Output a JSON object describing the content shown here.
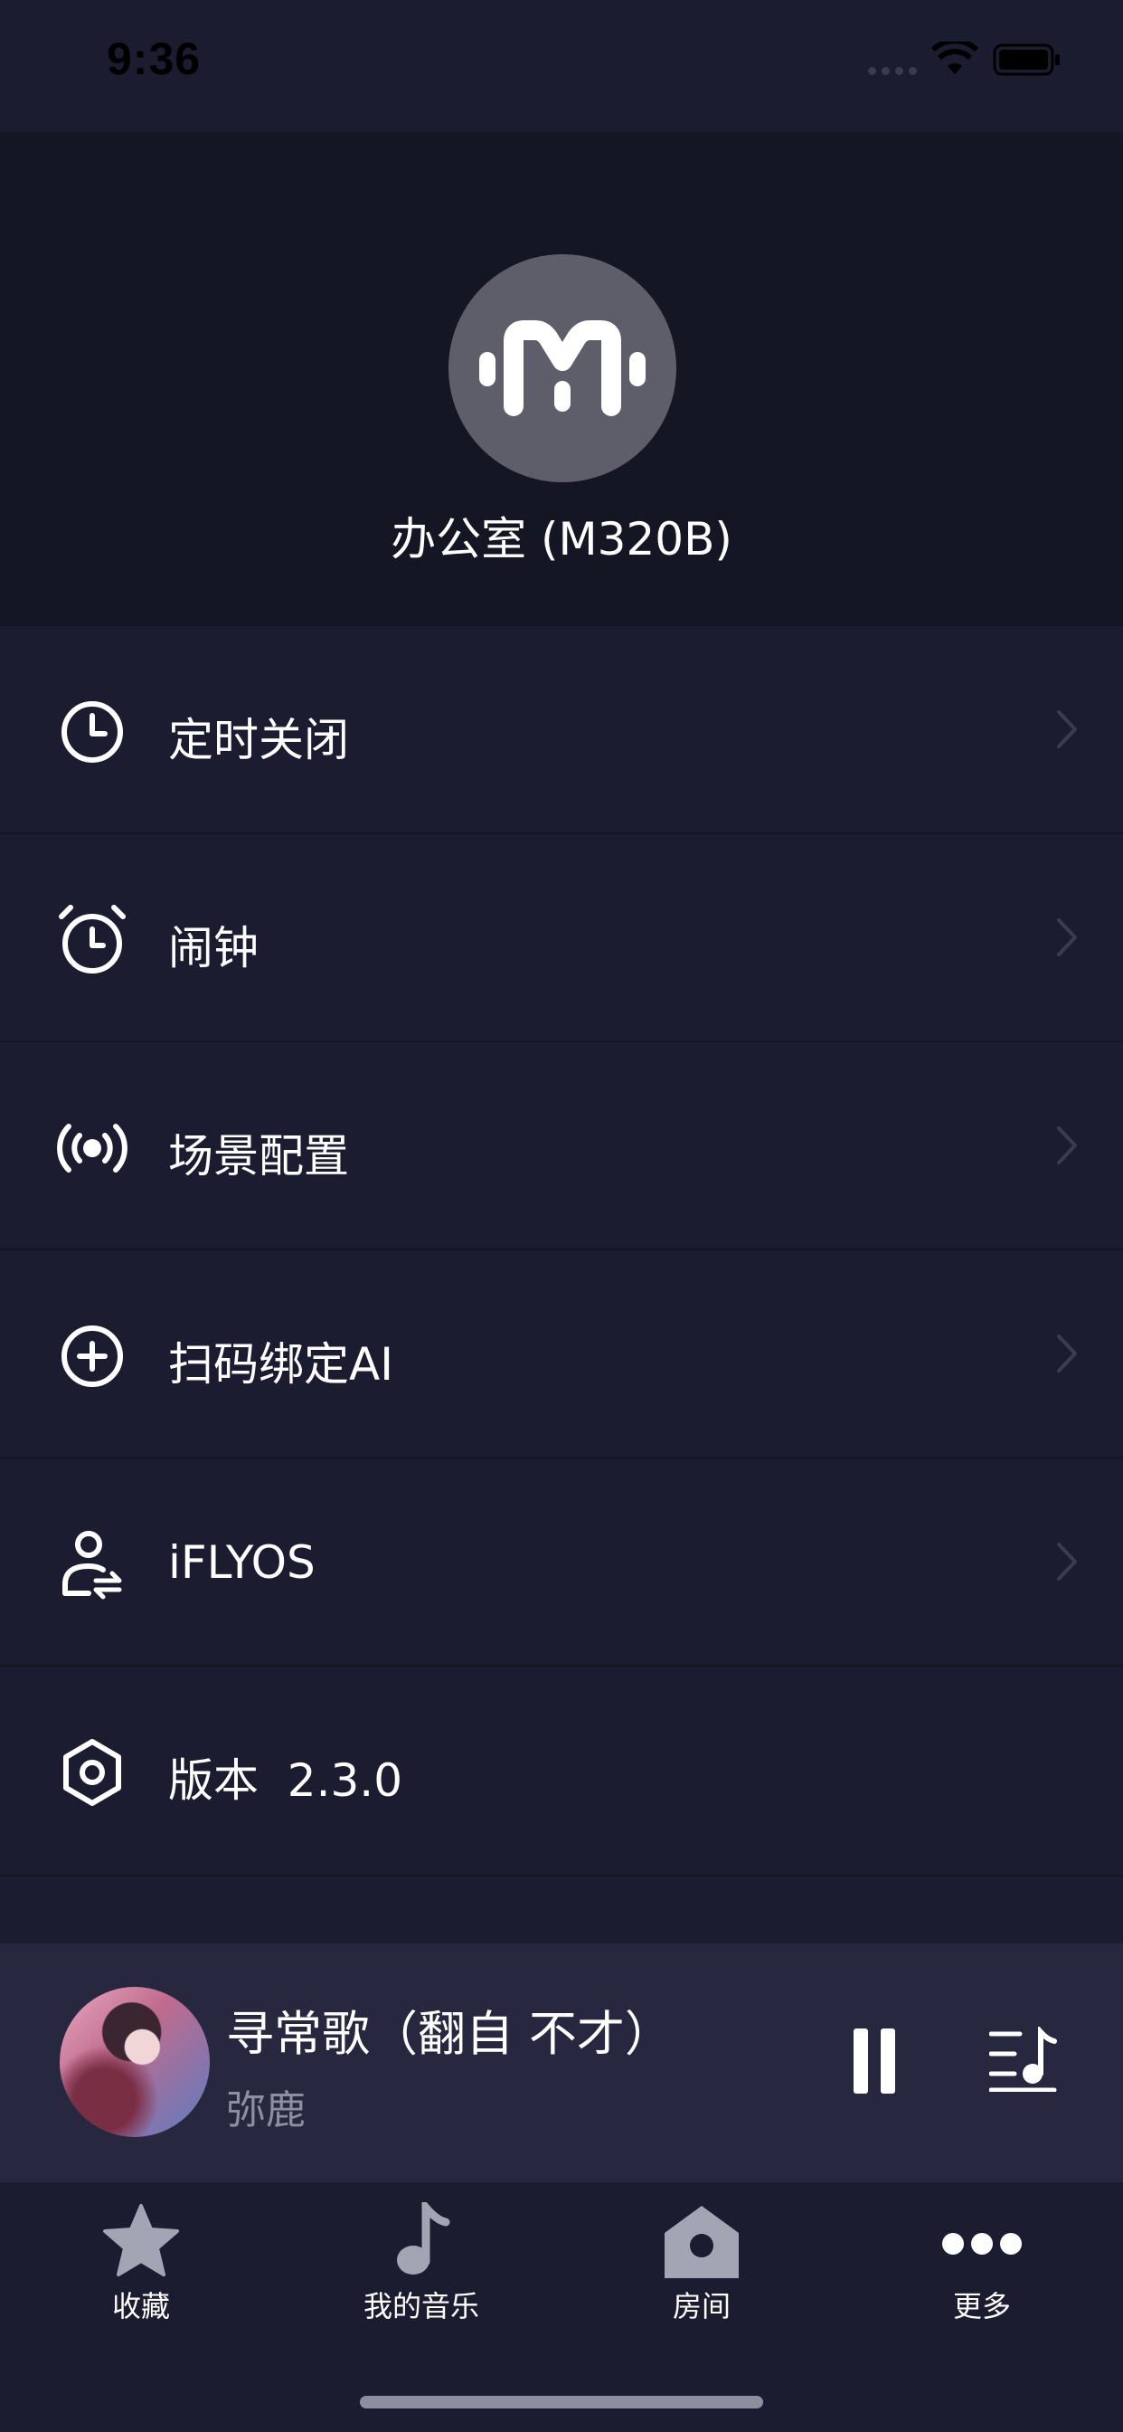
{
  "status_bar": {
    "time": "9:36"
  },
  "header": {
    "device_name": "办公室 (M320B)",
    "logo_icon": "m-logo-icon"
  },
  "menu": [
    {
      "icon": "clock-icon",
      "label": "定时关闭"
    },
    {
      "icon": "alarm-icon",
      "label": "闹钟"
    },
    {
      "icon": "broadcast-icon",
      "label": "场景配置"
    },
    {
      "icon": "plus-circle-icon",
      "label": "扫码绑定AI"
    },
    {
      "icon": "user-switch-icon",
      "label": "iFLYOS"
    },
    {
      "icon": "hexagon-icon",
      "label": "版本  2.3.0"
    }
  ],
  "player": {
    "title": "寻常歌（翻自 不才）",
    "artist": "弥鹿"
  },
  "tabs": [
    {
      "icon": "star-icon",
      "label": "收藏"
    },
    {
      "icon": "music-note-icon",
      "label": "我的音乐"
    },
    {
      "icon": "house-icon",
      "label": "房间"
    },
    {
      "icon": "more-icon",
      "label": "更多"
    }
  ],
  "colors": {
    "background": "#1b1c30",
    "header": "#151624",
    "player": "#27283f",
    "muted_text": "#8d8ea2"
  }
}
